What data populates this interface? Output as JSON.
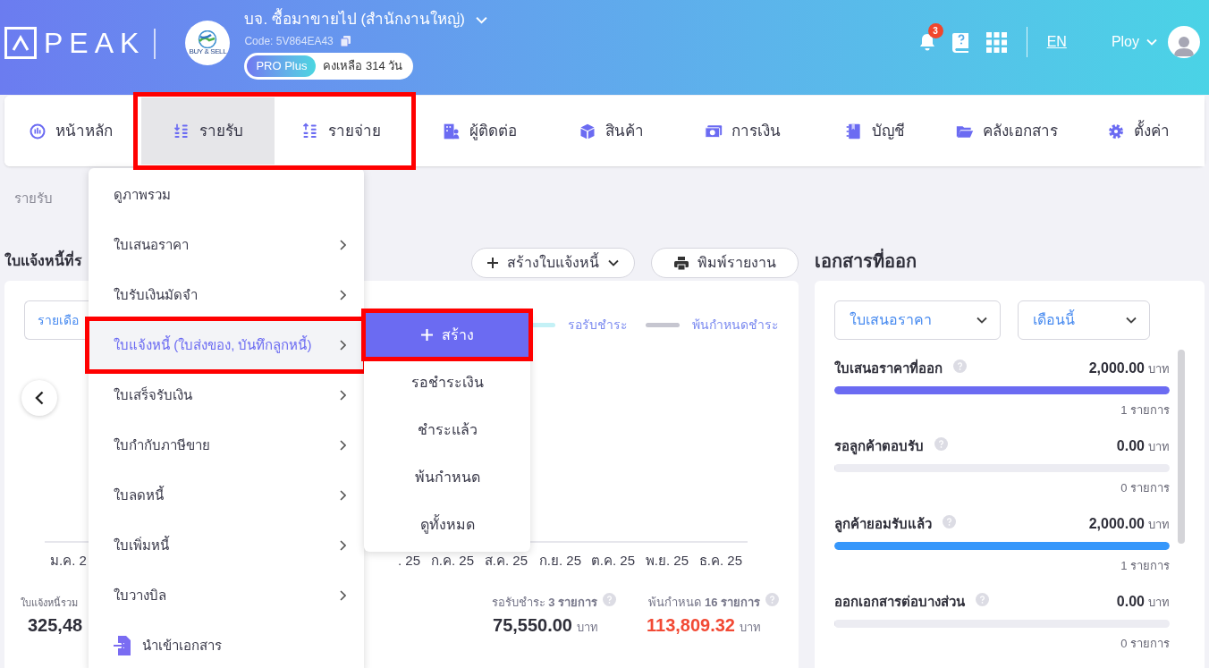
{
  "header": {
    "logo_text": "PEAK",
    "company_name": "บจ. ซื้อมาขายไป (สำนักงานใหญ่)",
    "company_logo_text": "BUY & SELL",
    "code": "Code: 5V864EA43",
    "plan": "PRO Plus",
    "remaining": "คงเหลือ 314 วัน",
    "notification_count": "3",
    "language": "EN",
    "user": "Ploy"
  },
  "nav": [
    {
      "label": "หน้าหลัก",
      "kind": "dashboard",
      "selected": false,
      "outlined": false
    },
    {
      "label": "รายรับ",
      "kind": "income",
      "selected": true,
      "outlined": true
    },
    {
      "label": "รายจ่าย",
      "kind": "expense",
      "selected": false,
      "outlined": true
    },
    {
      "label": "ผู้ติดต่อ",
      "kind": "contacts",
      "selected": false,
      "outlined": false
    },
    {
      "label": "สินค้า",
      "kind": "product",
      "selected": false,
      "outlined": false
    },
    {
      "label": "การเงิน",
      "kind": "finance",
      "selected": false,
      "outlined": false
    },
    {
      "label": "บัญชี",
      "kind": "accounting",
      "selected": false,
      "outlined": false
    },
    {
      "label": "คลังเอกสาร",
      "kind": "documents",
      "selected": false,
      "outlined": false
    },
    {
      "label": "ตั้งค่า",
      "kind": "settings",
      "selected": false,
      "outlined": false
    }
  ],
  "breadcrumb": "รายรับ",
  "page_title": "ใบแจ้งหนี้ที่ร",
  "actions": [
    {
      "label": "สร้างใบแจ้งหนี้",
      "kind": "create"
    },
    {
      "label": "พิมพ์รายงาน",
      "kind": "print"
    }
  ],
  "invoice_card": {
    "period_select": "รายเดือ",
    "legend": [
      {
        "label": "รอรับชำระ",
        "color": "#c4f1f6"
      },
      {
        "label": "พ้นกำหนดชำระ",
        "color": "#c6c6d0"
      }
    ],
    "first_month_label": "ม.ค. 2",
    "month_labels": [
      ". 25",
      "ก.ค. 25",
      "ส.ค. 25",
      "ก.ย. 25",
      "ต.ค. 25",
      "พ.ย. 25",
      "ธ.ค. 25"
    ],
    "total_label": "ใบแจ้งหนี้รวม",
    "total_value": "325,48",
    "stats": [
      {
        "label": "รอรับชำระ **3 รายการ**",
        "amount": "75,550.00",
        "unit": "บาท",
        "kind": "normal"
      },
      {
        "label": "พ้นกำหนด **16 รายการ**",
        "amount": "113,809.32",
        "unit": "บาท",
        "kind": "overdue"
      }
    ]
  },
  "issued_docs": {
    "title": "เอกสารที่ออก",
    "filters": [
      "ใบเสนอราคา",
      "เดือนนี้"
    ],
    "rows": [
      {
        "label": "ใบเสนอราคาที่ออก",
        "amount": "2,000.00",
        "unit": "บาท",
        "level": 1,
        "color": "#6b6bf2",
        "count": "1 รายการ"
      },
      {
        "label": "รอลูกค้าตอบรับ",
        "amount": "0.00",
        "unit": "บาท",
        "level": 0,
        "count": "0 รายการ"
      },
      {
        "label": "ลูกค้ายอมรับแล้ว",
        "amount": "2,000.00",
        "unit": "บาท",
        "level": 1,
        "color": "#3697fb",
        "count": "1 รายการ"
      },
      {
        "label": "ออกเอกสารต่อบางส่วน",
        "amount": "0.00",
        "unit": "บาท",
        "level": 0,
        "count": "0 รายการ"
      }
    ]
  },
  "menu": [
    {
      "label": "ดูภาพรวม",
      "kind": "plain",
      "has_submenu": false,
      "highlighted": false,
      "outlined": false
    },
    {
      "label": "ใบเสนอราคา",
      "kind": "plain",
      "has_submenu": true,
      "highlighted": false,
      "outlined": false
    },
    {
      "label": "ใบรับเงินมัดจำ",
      "kind": "plain",
      "has_submenu": true,
      "highlighted": false,
      "outlined": false
    },
    {
      "label": "ใบแจ้งหนี้ (ใบส่งของ, บันทึกลูกหนี้)",
      "kind": "plain",
      "has_submenu": true,
      "highlighted": true,
      "outlined": true
    },
    {
      "label": "ใบเสร็จรับเงิน",
      "kind": "plain",
      "has_submenu": true,
      "highlighted": false,
      "outlined": false
    },
    {
      "label": "ใบกำกับภาษีขาย",
      "kind": "plain",
      "has_submenu": true,
      "highlighted": false,
      "outlined": false
    },
    {
      "label": "ใบลดหนี้",
      "kind": "plain",
      "has_submenu": true,
      "highlighted": false,
      "outlined": false
    },
    {
      "label": "ใบเพิ่มหนี้",
      "kind": "plain",
      "has_submenu": true,
      "highlighted": false,
      "outlined": false
    },
    {
      "label": "ใบวางบิล",
      "kind": "plain",
      "has_submenu": true,
      "highlighted": false,
      "outlined": false
    },
    {
      "label": "นำเข้าเอกสาร",
      "kind": "import",
      "has_submenu": false,
      "highlighted": false,
      "outlined": false
    }
  ],
  "submenu": [
    {
      "label": "สร้าง",
      "kind": "create",
      "outlined": true
    },
    {
      "label": "รอชำระเงิน",
      "kind": "link",
      "outlined": false
    },
    {
      "label": "ชำระแล้ว",
      "kind": "link",
      "outlined": false
    },
    {
      "label": "พ้นกำหนด",
      "kind": "link",
      "outlined": false
    },
    {
      "label": "ดูทั้งหมด",
      "kind": "link",
      "outlined": false
    }
  ]
}
